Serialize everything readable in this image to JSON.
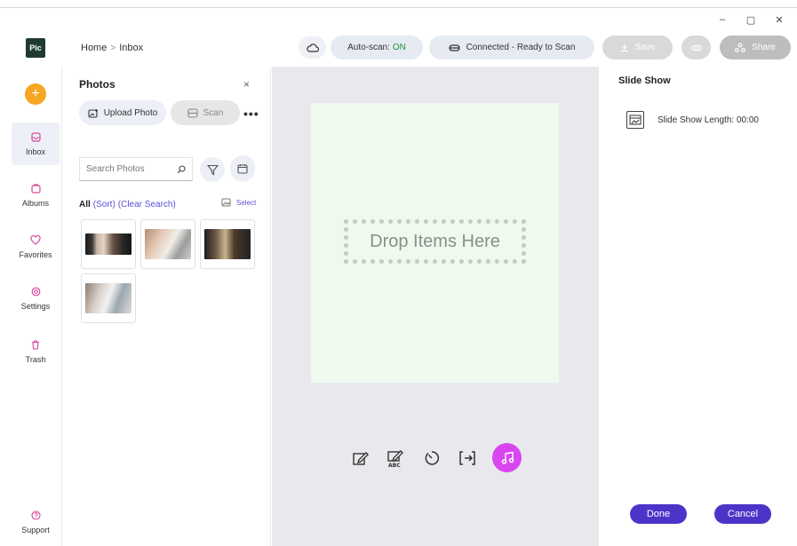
{
  "app": {
    "logo_text": "Pic",
    "brand_color": "#1f3a32"
  },
  "window": {
    "minimize": "–",
    "maximize": "▢",
    "close": "✕"
  },
  "breadcrumb": {
    "home": "Home",
    "separator": ">",
    "current": "Inbox"
  },
  "toolbar": {
    "autoscan_label": "Auto-scan:",
    "autoscan_value": "ON",
    "connection_status": "Connected - Ready to Scan",
    "save_label": "Save",
    "share_label": "Share"
  },
  "nav": {
    "add_symbol": "+",
    "items": [
      {
        "label": "Inbox",
        "icon": "inbox-icon",
        "active": true
      },
      {
        "label": "Albums",
        "icon": "albums-icon"
      },
      {
        "label": "Favorites",
        "icon": "heart-icon"
      },
      {
        "label": "Settings",
        "icon": "gear-icon"
      },
      {
        "label": "Trash",
        "icon": "trash-icon"
      },
      {
        "label": "Support",
        "icon": "help-icon"
      }
    ]
  },
  "photos": {
    "title": "Photos",
    "close": "×",
    "upload_label": "Upload Photo",
    "scan_label": "Scan",
    "more": "•••",
    "search_placeholder": "Search Photos",
    "filter_all": "All",
    "filter_sort": "(Sort)",
    "filter_clear": "(Clear Search)",
    "select_label": "Select",
    "thumbnails": [
      "photo-1",
      "photo-2",
      "photo-3",
      "photo-4"
    ]
  },
  "canvas": {
    "drop_text": "Drop Items Here",
    "accent": "#d946ef"
  },
  "slideshow": {
    "title": "Slide Show",
    "length_label": "Slide Show Length:",
    "length_value": "00:00",
    "done_label": "Done",
    "cancel_label": "Cancel",
    "button_color": "#4b35c9"
  }
}
